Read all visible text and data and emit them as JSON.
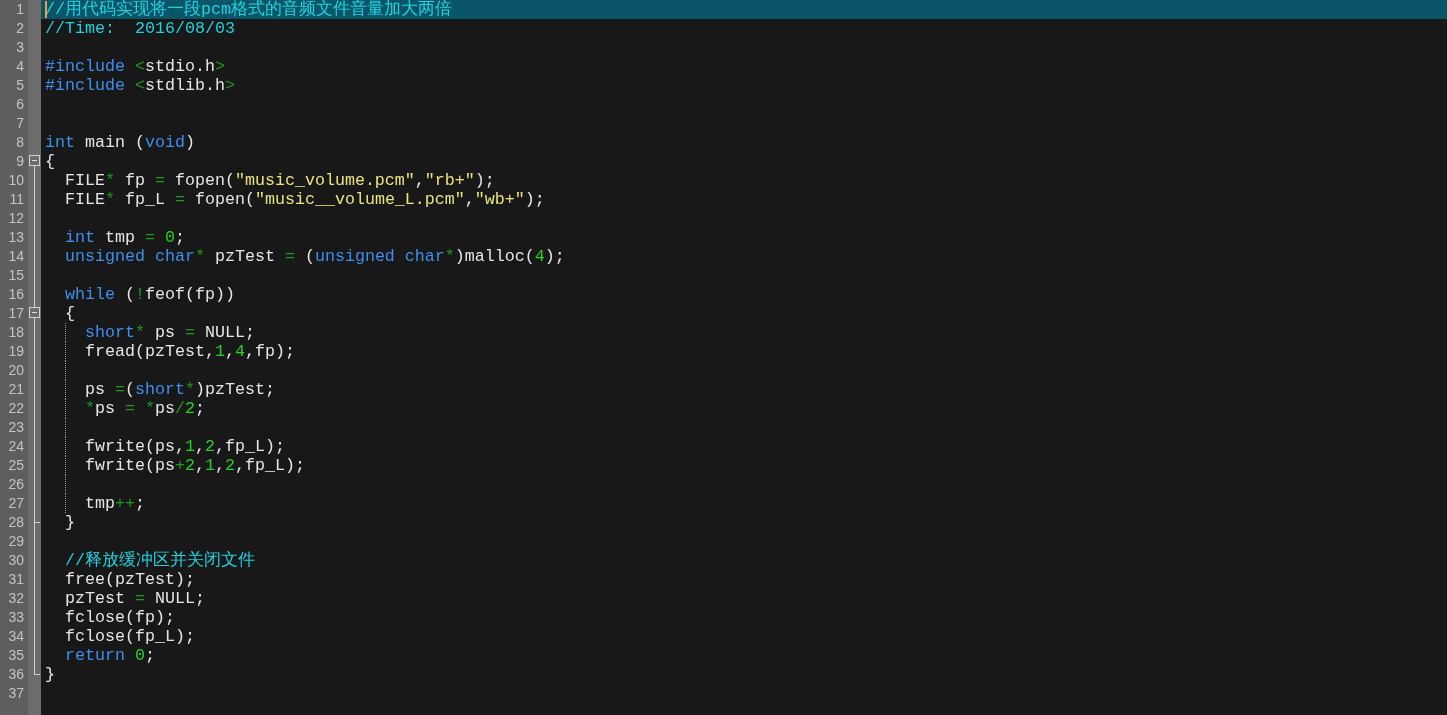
{
  "editor": {
    "lines": [
      {
        "number": "1",
        "selected": true,
        "kind": "plain",
        "tokens": [
          {
            "kind": "comment",
            "text": "//用代码实现将一段pcm格式的音频文件音量加大两倍"
          }
        ]
      },
      {
        "number": "2",
        "selected": false,
        "kind": "plain",
        "tokens": [
          {
            "kind": "comment",
            "text": "//Time:  2016/08/03"
          }
        ]
      },
      {
        "number": "3",
        "selected": false,
        "kind": "plain"
      },
      {
        "number": "4",
        "selected": false,
        "kind": "plain",
        "tokens": [
          {
            "kind": "keyword",
            "text": "#include"
          },
          {
            "kind": "operator",
            "text": " <"
          },
          {
            "kind": "plain",
            "text": "stdio.h"
          },
          {
            "kind": "operator",
            "text": ">"
          }
        ]
      },
      {
        "number": "5",
        "selected": false,
        "kind": "plain",
        "tokens": [
          {
            "kind": "keyword",
            "text": "#include"
          },
          {
            "kind": "operator",
            "text": " <"
          },
          {
            "kind": "plain",
            "text": "stdlib.h"
          },
          {
            "kind": "operator",
            "text": ">"
          }
        ]
      },
      {
        "number": "6",
        "selected": false,
        "kind": "plain"
      },
      {
        "number": "7",
        "selected": false,
        "kind": "plain"
      },
      {
        "number": "8",
        "selected": false,
        "kind": "plain",
        "tokens": [
          {
            "kind": "keyword",
            "text": "int"
          },
          {
            "kind": "plain",
            "text": " main ("
          },
          {
            "kind": "keyword",
            "text": "void"
          },
          {
            "kind": "plain",
            "text": ")"
          }
        ]
      },
      {
        "number": "9",
        "selected": false,
        "kind": "foldstart",
        "tokens": [
          {
            "kind": "plain",
            "text": "{"
          }
        ]
      },
      {
        "number": "10",
        "selected": false,
        "kind": "plain",
        "tokens": [
          {
            "kind": "plain",
            "text": "  FILE"
          },
          {
            "kind": "operator",
            "text": "*"
          },
          {
            "kind": "plain",
            "text": " fp "
          },
          {
            "kind": "operator",
            "text": "="
          },
          {
            "kind": "plain",
            "text": " fopen("
          },
          {
            "kind": "string",
            "text": "\"music_volume.pcm\""
          },
          {
            "kind": "plain",
            "text": ","
          },
          {
            "kind": "string",
            "text": "\"rb+\""
          },
          {
            "kind": "plain",
            "text": ");"
          }
        ]
      },
      {
        "number": "11",
        "selected": false,
        "kind": "plain",
        "tokens": [
          {
            "kind": "plain",
            "text": "  FILE"
          },
          {
            "kind": "operator",
            "text": "*"
          },
          {
            "kind": "plain",
            "text": " fp_L "
          },
          {
            "kind": "operator",
            "text": "="
          },
          {
            "kind": "plain",
            "text": " fopen("
          },
          {
            "kind": "string",
            "text": "\"music__volume_L.pcm\""
          },
          {
            "kind": "plain",
            "text": ","
          },
          {
            "kind": "string",
            "text": "\"wb+\""
          },
          {
            "kind": "plain",
            "text": ");"
          }
        ]
      },
      {
        "number": "12",
        "selected": false,
        "kind": "plain"
      },
      {
        "number": "13",
        "selected": false,
        "kind": "plain",
        "tokens": [
          {
            "kind": "keyword",
            "text": "  int"
          },
          {
            "kind": "plain",
            "text": " tmp "
          },
          {
            "kind": "operator",
            "text": "="
          },
          {
            "kind": "number",
            "text": " 0"
          },
          {
            "kind": "plain",
            "text": ";"
          }
        ]
      },
      {
        "number": "14",
        "selected": false,
        "kind": "plain",
        "tokens": [
          {
            "kind": "keyword",
            "text": "  unsigned char"
          },
          {
            "kind": "operator",
            "text": "*"
          },
          {
            "kind": "plain",
            "text": " pzTest "
          },
          {
            "kind": "operator",
            "text": "="
          },
          {
            "kind": "plain",
            "text": " ("
          },
          {
            "kind": "keyword",
            "text": "unsigned char"
          },
          {
            "kind": "operator",
            "text": "*"
          },
          {
            "kind": "plain",
            "text": ")malloc("
          },
          {
            "kind": "number",
            "text": "4"
          },
          {
            "kind": "plain",
            "text": ");"
          }
        ]
      },
      {
        "number": "15",
        "selected": false,
        "kind": "plain"
      },
      {
        "number": "16",
        "selected": false,
        "kind": "plain",
        "tokens": [
          {
            "kind": "keyword",
            "text": "  while"
          },
          {
            "kind": "plain",
            "text": " ("
          },
          {
            "kind": "operator",
            "text": "!"
          },
          {
            "kind": "plain",
            "text": "feof(fp))"
          }
        ]
      },
      {
        "number": "17",
        "selected": false,
        "kind": "foldstart",
        "tokens": [
          {
            "kind": "plain",
            "text": "  {"
          }
        ]
      },
      {
        "number": "18",
        "selected": false,
        "kind": "plain",
        "tokens": [
          {
            "kind": "keyword",
            "text": "    short"
          },
          {
            "kind": "operator",
            "text": "*"
          },
          {
            "kind": "plain",
            "text": " ps "
          },
          {
            "kind": "operator",
            "text": "="
          },
          {
            "kind": "plain",
            "text": " NULL;"
          }
        ]
      },
      {
        "number": "19",
        "selected": false,
        "kind": "plain",
        "tokens": [
          {
            "kind": "plain",
            "text": "    fread(pzTest,"
          },
          {
            "kind": "number",
            "text": "1"
          },
          {
            "kind": "plain",
            "text": ","
          },
          {
            "kind": "number",
            "text": "4"
          },
          {
            "kind": "plain",
            "text": ",fp);"
          }
        ]
      },
      {
        "number": "20",
        "selected": false,
        "kind": "plain"
      },
      {
        "number": "21",
        "selected": false,
        "kind": "plain",
        "tokens": [
          {
            "kind": "plain",
            "text": "    ps "
          },
          {
            "kind": "operator",
            "text": "="
          },
          {
            "kind": "plain",
            "text": "("
          },
          {
            "kind": "keyword",
            "text": "short"
          },
          {
            "kind": "operator",
            "text": "*"
          },
          {
            "kind": "plain",
            "text": ")pzTest;"
          }
        ]
      },
      {
        "number": "22",
        "selected": false,
        "kind": "plain",
        "tokens": [
          {
            "kind": "operator",
            "text": "    *"
          },
          {
            "kind": "plain",
            "text": "ps "
          },
          {
            "kind": "operator",
            "text": "= *"
          },
          {
            "kind": "plain",
            "text": "ps"
          },
          {
            "kind": "operator",
            "text": "/"
          },
          {
            "kind": "number",
            "text": "2"
          },
          {
            "kind": "plain",
            "text": ";"
          }
        ]
      },
      {
        "number": "23",
        "selected": false,
        "kind": "plain"
      },
      {
        "number": "24",
        "selected": false,
        "kind": "plain",
        "tokens": [
          {
            "kind": "plain",
            "text": "    fwrite(ps,"
          },
          {
            "kind": "number",
            "text": "1"
          },
          {
            "kind": "plain",
            "text": ","
          },
          {
            "kind": "number",
            "text": "2"
          },
          {
            "kind": "plain",
            "text": ",fp_L);"
          }
        ]
      },
      {
        "number": "25",
        "selected": false,
        "kind": "plain",
        "tokens": [
          {
            "kind": "plain",
            "text": "    fwrite(ps"
          },
          {
            "kind": "operator",
            "text": "+"
          },
          {
            "kind": "number",
            "text": "2"
          },
          {
            "kind": "plain",
            "text": ","
          },
          {
            "kind": "number",
            "text": "1"
          },
          {
            "kind": "plain",
            "text": ","
          },
          {
            "kind": "number",
            "text": "2"
          },
          {
            "kind": "plain",
            "text": ",fp_L);"
          }
        ]
      },
      {
        "number": "26",
        "selected": false,
        "kind": "plain"
      },
      {
        "number": "27",
        "selected": false,
        "kind": "plain",
        "tokens": [
          {
            "kind": "plain",
            "text": "    tmp"
          },
          {
            "kind": "operator",
            "text": "++"
          },
          {
            "kind": "plain",
            "text": ";"
          }
        ]
      },
      {
        "number": "28",
        "selected": false,
        "kind": "foldend",
        "tokens": [
          {
            "kind": "plain",
            "text": "  }"
          }
        ]
      },
      {
        "number": "29",
        "selected": false,
        "kind": "plain"
      },
      {
        "number": "30",
        "selected": false,
        "kind": "plain",
        "tokens": [
          {
            "kind": "comment",
            "text": "  //释放缓冲区并关闭文件"
          }
        ]
      },
      {
        "number": "31",
        "selected": false,
        "kind": "plain",
        "tokens": [
          {
            "kind": "plain",
            "text": "  free(pzTest);"
          }
        ]
      },
      {
        "number": "32",
        "selected": false,
        "kind": "plain",
        "tokens": [
          {
            "kind": "plain",
            "text": "  pzTest "
          },
          {
            "kind": "operator",
            "text": "="
          },
          {
            "kind": "plain",
            "text": " NULL;"
          }
        ]
      },
      {
        "number": "33",
        "selected": false,
        "kind": "plain",
        "tokens": [
          {
            "kind": "plain",
            "text": "  fclose(fp);"
          }
        ]
      },
      {
        "number": "34",
        "selected": false,
        "kind": "plain",
        "tokens": [
          {
            "kind": "plain",
            "text": "  fclose(fp_L);"
          }
        ]
      },
      {
        "number": "35",
        "selected": false,
        "kind": "plain",
        "tokens": [
          {
            "kind": "keyword",
            "text": "  return"
          },
          {
            "kind": "number",
            "text": " 0"
          },
          {
            "kind": "plain",
            "text": ";"
          }
        ]
      },
      {
        "number": "36",
        "selected": false,
        "kind": "foldend",
        "tokens": [
          {
            "kind": "plain",
            "text": "}"
          }
        ]
      },
      {
        "number": "37",
        "selected": false,
        "kind": "plain"
      }
    ]
  }
}
